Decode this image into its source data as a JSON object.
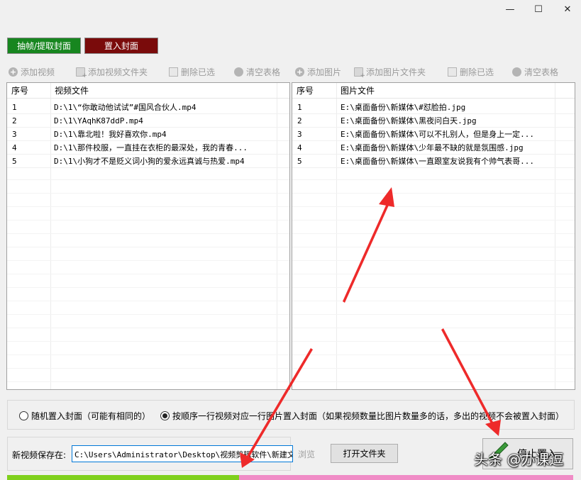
{
  "window": {
    "minimize_glyph": "—",
    "maximize_glyph": "☐",
    "close_glyph": "✕"
  },
  "mode_tabs": [
    {
      "label": "抽帧/提取封面",
      "color": "#17861f"
    },
    {
      "label": "置入封面",
      "color": "#7a0b0b"
    }
  ],
  "toolbar": {
    "add_video": "添加视频",
    "add_video_folder": "添加视频文件夹",
    "delete_selected_video": "删除已选",
    "clear_video_table": "清空表格",
    "add_image": "添加图片",
    "add_image_folder": "添加图片文件夹",
    "delete_selected_image": "删除已选",
    "clear_image_table": "清空表格"
  },
  "video_table": {
    "col_index": "序号",
    "col_file": "视频文件",
    "rows": [
      {
        "index": "1",
        "file": "D:\\1\\“你敢动他试试”#国风合伙人.mp4"
      },
      {
        "index": "2",
        "file": "D:\\1\\YAqhK87ddP.mp4"
      },
      {
        "index": "3",
        "file": "D:\\1\\靠北啦！我好喜欢你.mp4"
      },
      {
        "index": "4",
        "file": "D:\\1\\那件校服，一直挂在衣柜的最深处，我的青春..."
      },
      {
        "index": "5",
        "file": "D:\\1\\小狗才不是贬义词小狗的爱永远真诚与热爱.mp4"
      }
    ]
  },
  "image_table": {
    "col_index": "序号",
    "col_file": "图片文件",
    "rows": [
      {
        "index": "1",
        "file": "E:\\桌面备份\\新媒体\\#怼脸拍.jpg"
      },
      {
        "index": "2",
        "file": "E:\\桌面备份\\新媒体\\黑夜问白天.jpg"
      },
      {
        "index": "3",
        "file": "E:\\桌面备份\\新媒体\\可以不扎别人，但是身上一定..."
      },
      {
        "index": "4",
        "file": "E:\\桌面备份\\新媒体\\少年最不缺的就是氛围感.jpg"
      },
      {
        "index": "5",
        "file": "E:\\桌面备份\\新媒体\\一直跟室友说我有个帅气表哥..."
      }
    ]
  },
  "options": {
    "random_label": "随机置入封面（可能有相同的）",
    "sequential_label": "按顺序一行视频对应一行图片置入封面（如果视频数量比图片数量多的话，多出的视频不会被置入封面）",
    "selected": "sequential"
  },
  "save": {
    "label": "新视频保存在:",
    "path": "C:\\Users\\Administrator\\Desktop\\视频剪辑软件\\新建文件",
    "browse_label": "浏览",
    "open_folder_label": "打开文件夹"
  },
  "start_button": {
    "label": "停止置入"
  },
  "progress": {
    "fraction": 0.41,
    "done_color": "#7fd01c",
    "remaining_color": "#f08cc6"
  },
  "watermark": "头条 @办课逗"
}
